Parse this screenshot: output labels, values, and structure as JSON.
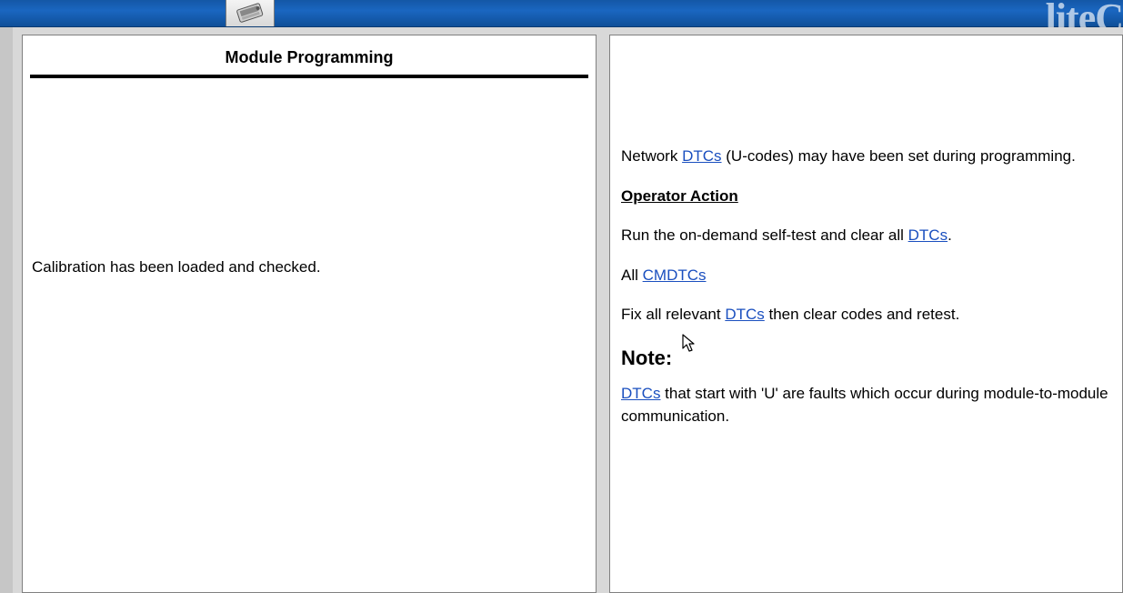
{
  "brand_watermark": "liteC",
  "left": {
    "heading": "Module Programming",
    "status_text": "Calibration has been loaded and checked."
  },
  "right": {
    "line1_pre": "Network ",
    "line1_link": "DTCs",
    "line1_post": " (U-codes) may have been set during programming.",
    "operator_action_label": "Operator Action",
    "line2_pre": "Run the on-demand self-test and clear all ",
    "line2_link": "DTCs",
    "line2_post": ".",
    "line3_pre": "All ",
    "line3_link": "CMDTCs",
    "line4_pre": "Fix all relevant ",
    "line4_link": "DTCs",
    "line4_post": " then clear codes and retest.",
    "note_label": "Note:",
    "note_link": "DTCs",
    "note_post": " that start with 'U' are faults which occur during module-to-module communication."
  }
}
